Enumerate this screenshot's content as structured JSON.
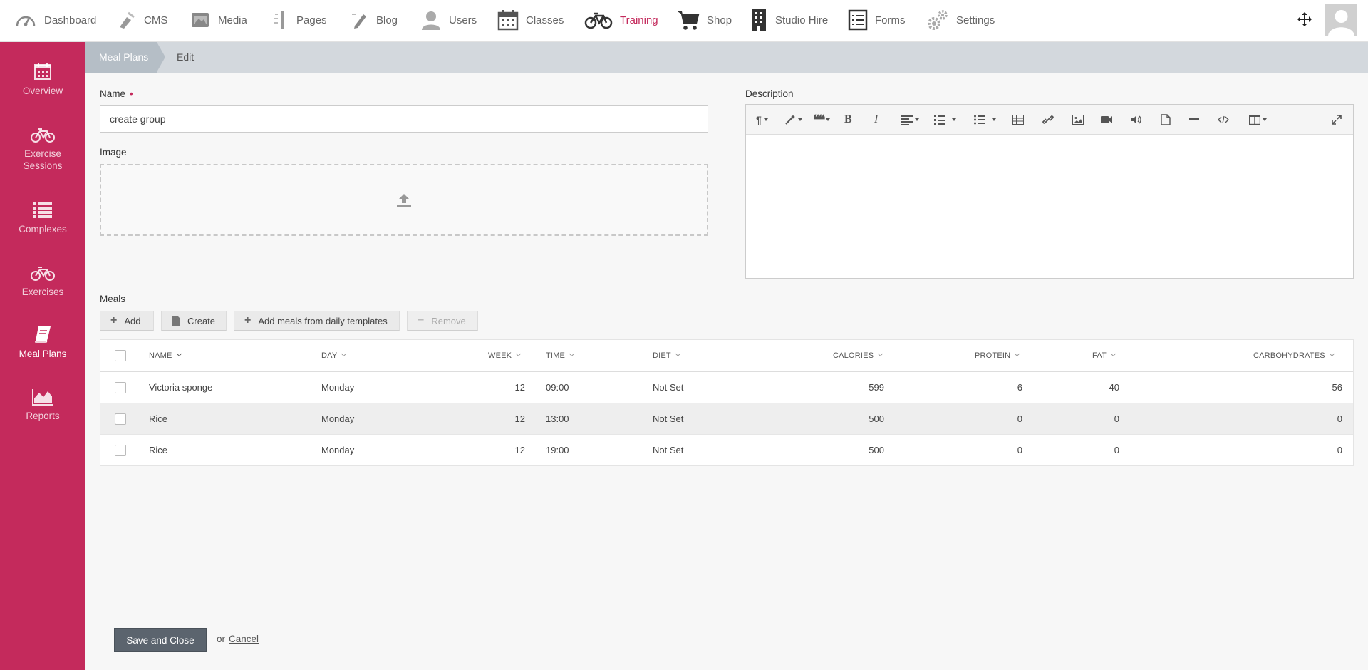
{
  "topnav": {
    "items": [
      {
        "label": "Dashboard",
        "icon": "dashboard-icon"
      },
      {
        "label": "CMS",
        "icon": "cms-icon"
      },
      {
        "label": "Media",
        "icon": "media-icon"
      },
      {
        "label": "Pages",
        "icon": "pages-icon"
      },
      {
        "label": "Blog",
        "icon": "blog-icon"
      },
      {
        "label": "Users",
        "icon": "users-icon"
      },
      {
        "label": "Classes",
        "icon": "calendar-icon"
      },
      {
        "label": "Training",
        "icon": "bicycle-icon",
        "active": true
      },
      {
        "label": "Shop",
        "icon": "cart-icon"
      },
      {
        "label": "Studio Hire",
        "icon": "building-icon"
      },
      {
        "label": "Forms",
        "icon": "forms-icon"
      },
      {
        "label": "Settings",
        "icon": "gears-icon"
      }
    ]
  },
  "sidebar": {
    "items": [
      {
        "label": "Overview",
        "icon": "calendar-icon"
      },
      {
        "label": "Exercise Sessions",
        "icon": "bicycle-icon"
      },
      {
        "label": "Complexes",
        "icon": "list-icon"
      },
      {
        "label": "Exercises",
        "icon": "bicycle-icon"
      },
      {
        "label": "Meal Plans",
        "icon": "book-icon",
        "active": true
      },
      {
        "label": "Reports",
        "icon": "area-chart-icon"
      }
    ]
  },
  "breadcrumb": {
    "parent": "Meal Plans",
    "current": "Edit"
  },
  "form": {
    "name_label": "Name",
    "name_required": "•",
    "name_value": "create group",
    "image_label": "Image",
    "description_label": "Description"
  },
  "meals": {
    "label": "Meals",
    "buttons": {
      "add": "Add",
      "create": "Create",
      "add_templates": "Add meals from daily templates",
      "remove": "Remove"
    },
    "columns": [
      "Name",
      "Day",
      "Week",
      "Time",
      "Diet",
      "Calories",
      "Protein",
      "Fat",
      "Carbohydrates"
    ],
    "rows": [
      {
        "name": "Victoria sponge",
        "day": "Monday",
        "week": "12",
        "time": "09:00",
        "diet": "Not Set",
        "calories": "599",
        "protein": "6",
        "fat": "40",
        "carbohydrates": "56"
      },
      {
        "name": "Rice",
        "day": "Monday",
        "week": "12",
        "time": "13:00",
        "diet": "Not Set",
        "calories": "500",
        "protein": "0",
        "fat": "0",
        "carbohydrates": "0"
      },
      {
        "name": "Rice",
        "day": "Monday",
        "week": "12",
        "time": "19:00",
        "diet": "Not Set",
        "calories": "500",
        "protein": "0",
        "fat": "0",
        "carbohydrates": "0"
      }
    ]
  },
  "footer": {
    "save": "Save and Close",
    "or": "or",
    "cancel": "Cancel"
  },
  "colors": {
    "accent": "#c42a5c",
    "breadcrumb_bg": "#d3d8dd",
    "save_button": "#5b646e"
  }
}
